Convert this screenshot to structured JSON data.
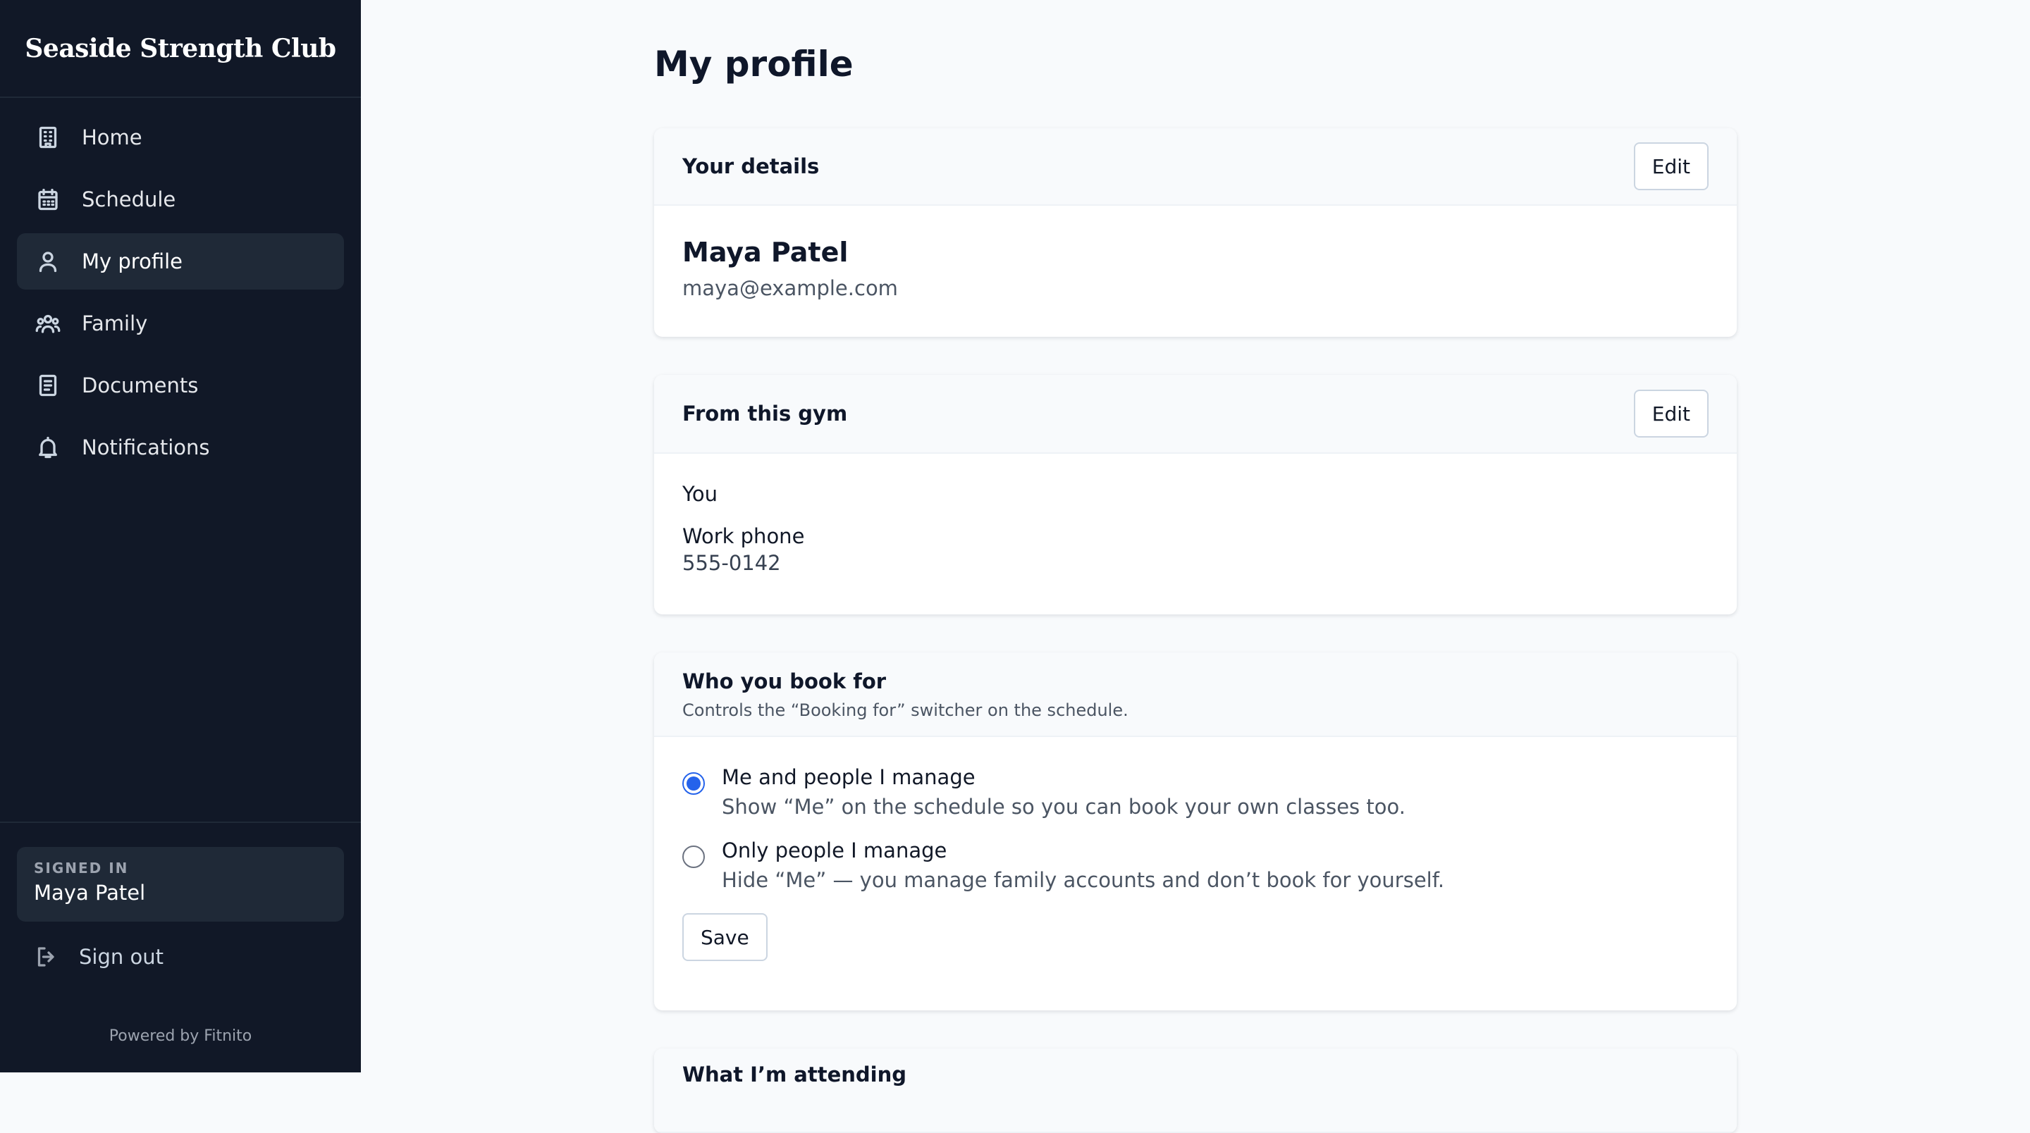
{
  "brand": "Seaside Strength Club",
  "nav": [
    {
      "label": "Home",
      "icon": "building-icon"
    },
    {
      "label": "Schedule",
      "icon": "calendar-icon"
    },
    {
      "label": "My profile",
      "icon": "user-icon",
      "active": true
    },
    {
      "label": "Family",
      "icon": "people-icon"
    },
    {
      "label": "Documents",
      "icon": "document-icon"
    },
    {
      "label": "Notifications",
      "icon": "bell-icon"
    }
  ],
  "footer": {
    "signed_in_label": "SIGNED IN",
    "signed_in_name": "Maya Patel",
    "sign_out": "Sign out",
    "powered_by": "Powered by Fitnito"
  },
  "page": {
    "title": "My profile"
  },
  "details": {
    "title": "Your details",
    "edit_label": "Edit",
    "name": "Maya Patel",
    "email": "maya@example.com"
  },
  "gym": {
    "title": "From this gym",
    "edit_label": "Edit",
    "you_label": "You",
    "work_phone_label": "Work phone",
    "work_phone_value": "555-0142"
  },
  "booking": {
    "title": "Who you book for",
    "subtitle": "Controls the “Booking for” switcher on the schedule.",
    "options": [
      {
        "label": "Me and people I manage",
        "desc": "Show “Me” on the schedule so you can book your own classes too.",
        "selected": true
      },
      {
        "label": "Only people I manage",
        "desc": "Hide “Me” — you manage family accounts and don’t book for yourself.",
        "selected": false
      }
    ],
    "save_label": "Save"
  },
  "attending": {
    "title": "What I’m attending"
  },
  "colors": {
    "sidebar_bg": "#111827",
    "accent": "#2563eb",
    "page_bg": "#f8fafc"
  }
}
